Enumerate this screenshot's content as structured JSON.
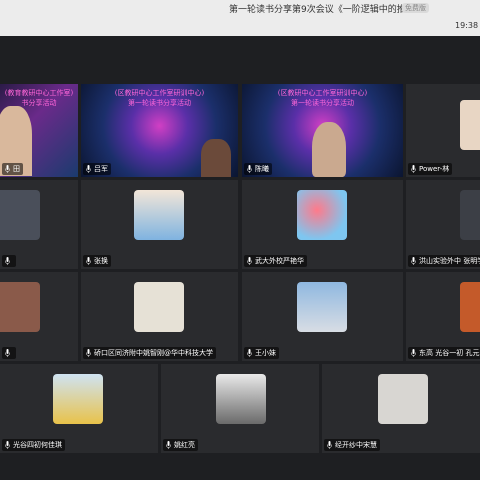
{
  "header": {
    "title": "第一轮读书分享第9次会议《一阶逻辑中的推断》",
    "badge": "免费版",
    "time": "19:38"
  },
  "tiles": [
    {
      "name": "田",
      "overlay": "(教育教研中心工作室)\n书分享活动"
    },
    {
      "name": "吕军",
      "overlay": "(区教研中心工作室研训中心)\n第一轮读书分享活动"
    },
    {
      "name": "陈曦",
      "overlay": "(区教研中心工作室研训中心)\n第一轮读书分享活动"
    },
    {
      "name": "Power-林"
    },
    {
      "name": ""
    },
    {
      "name": "张换"
    },
    {
      "name": "武大外校严艳华"
    },
    {
      "name": "洪山实验外中 张明学"
    },
    {
      "name": ""
    },
    {
      "name": "硚口区同济附中姚智刚@华中科技大学"
    },
    {
      "name": "王小妹"
    },
    {
      "name": "东高 光谷一初 孔元"
    },
    {
      "name": "光谷四初何佳琪"
    },
    {
      "name": "姚红亮"
    },
    {
      "name": "经开纱中宋慧"
    }
  ],
  "colors": {
    "accent": "#ff66d9",
    "background": "#1e1f22"
  }
}
